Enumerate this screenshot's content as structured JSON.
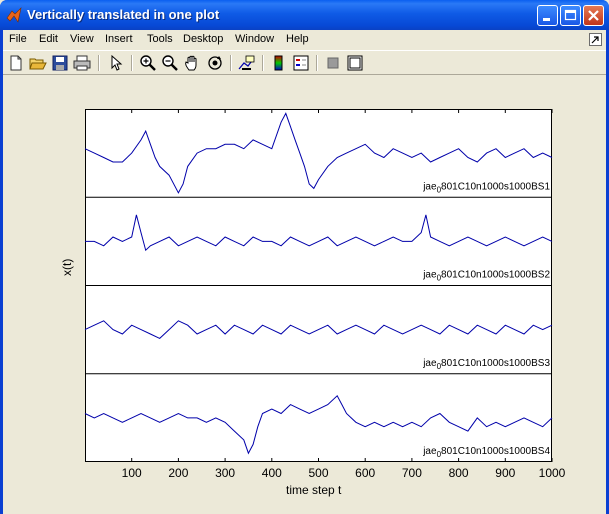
{
  "window": {
    "title": "Vertically translated in one plot"
  },
  "menu": {
    "items": [
      "File",
      "Edit",
      "View",
      "Insert",
      "Tools",
      "Desktop",
      "Window",
      "Help"
    ]
  },
  "toolbar": {
    "icons": [
      "new-figure-icon",
      "open-file-icon",
      "save-icon",
      "print-icon",
      "pointer-icon",
      "zoom-in-icon",
      "zoom-out-icon",
      "pan-icon",
      "rotate-3d-icon",
      "data-cursor-icon",
      "colorbar-icon",
      "legend-icon",
      "hide-plot-tools-icon",
      "show-plot-tools-icon"
    ]
  },
  "chart_data": {
    "type": "line",
    "xlabel": "time step t",
    "ylabel": "x(t)",
    "xlim": [
      0,
      1000
    ],
    "xticks": [
      100,
      200,
      300,
      400,
      500,
      600,
      700,
      800,
      900,
      1000
    ],
    "line_color": "#0000aa",
    "series": [
      {
        "name_prefix": "jae",
        "name_sub": "0",
        "name_suffix": "801C10n1000s1000BS1",
        "x": [
          0,
          20,
          40,
          60,
          80,
          100,
          120,
          130,
          140,
          150,
          160,
          180,
          200,
          210,
          220,
          240,
          260,
          280,
          300,
          320,
          340,
          360,
          380,
          400,
          420,
          430,
          440,
          450,
          460,
          470,
          480,
          490,
          500,
          520,
          540,
          560,
          580,
          600,
          620,
          640,
          660,
          680,
          700,
          720,
          740,
          760,
          780,
          800,
          820,
          840,
          860,
          880,
          900,
          920,
          940,
          960,
          980,
          1000
        ],
        "y": [
          0.1,
          0.0,
          -0.1,
          -0.2,
          -0.2,
          0.0,
          0.3,
          0.5,
          0.2,
          -0.1,
          -0.3,
          -0.5,
          -0.9,
          -0.7,
          -0.3,
          0.0,
          0.1,
          0.1,
          0.2,
          0.2,
          0.1,
          0.3,
          0.2,
          0.1,
          0.7,
          0.9,
          0.6,
          0.3,
          0.0,
          -0.3,
          -0.7,
          -0.8,
          -0.6,
          -0.3,
          -0.1,
          0.0,
          0.1,
          0.2,
          0.0,
          -0.1,
          0.1,
          0.0,
          -0.1,
          0.0,
          -0.2,
          -0.1,
          0.0,
          0.1,
          -0.1,
          -0.2,
          0.0,
          0.1,
          -0.1,
          0.0,
          0.1,
          -0.1,
          0.0,
          -0.1
        ]
      },
      {
        "name_prefix": "jae",
        "name_sub": "0",
        "name_suffix": "801C10n1000s1000BS2",
        "x": [
          0,
          20,
          40,
          60,
          80,
          100,
          110,
          120,
          130,
          140,
          160,
          180,
          200,
          220,
          240,
          260,
          280,
          300,
          320,
          340,
          360,
          380,
          400,
          420,
          440,
          460,
          480,
          500,
          520,
          540,
          560,
          580,
          600,
          620,
          640,
          660,
          680,
          700,
          720,
          730,
          740,
          760,
          780,
          800,
          820,
          840,
          860,
          880,
          900,
          920,
          940,
          960,
          980,
          1000
        ],
        "y": [
          0.0,
          0.0,
          -0.1,
          0.1,
          0.0,
          0.1,
          0.6,
          0.2,
          -0.2,
          -0.1,
          0.0,
          0.1,
          -0.1,
          0.0,
          0.1,
          0.0,
          -0.1,
          0.1,
          0.0,
          -0.1,
          0.1,
          0.0,
          0.0,
          -0.1,
          0.1,
          0.0,
          -0.1,
          0.0,
          0.1,
          -0.1,
          0.0,
          0.1,
          0.0,
          -0.1,
          0.0,
          0.1,
          0.0,
          0.0,
          0.2,
          0.6,
          0.1,
          0.0,
          -0.1,
          0.0,
          0.1,
          0.0,
          -0.1,
          0.0,
          0.1,
          0.0,
          -0.1,
          0.0,
          0.1,
          0.0
        ]
      },
      {
        "name_prefix": "jae",
        "name_sub": "0",
        "name_suffix": "801C10n1000s1000BS3",
        "x": [
          0,
          20,
          40,
          60,
          80,
          100,
          120,
          140,
          160,
          180,
          200,
          220,
          240,
          260,
          280,
          300,
          320,
          340,
          360,
          380,
          400,
          420,
          440,
          460,
          480,
          500,
          520,
          540,
          560,
          580,
          600,
          620,
          640,
          660,
          680,
          700,
          720,
          740,
          760,
          780,
          800,
          820,
          840,
          860,
          880,
          900,
          920,
          940,
          960,
          980,
          1000
        ],
        "y": [
          0.0,
          0.1,
          0.2,
          0.0,
          -0.1,
          0.1,
          0.0,
          -0.1,
          -0.2,
          0.0,
          0.2,
          0.1,
          -0.1,
          0.0,
          0.1,
          -0.1,
          0.1,
          0.0,
          -0.1,
          0.1,
          0.0,
          -0.1,
          0.1,
          0.0,
          -0.1,
          0.0,
          0.1,
          -0.1,
          0.0,
          0.1,
          0.0,
          -0.1,
          0.1,
          0.0,
          -0.1,
          0.0,
          0.1,
          0.0,
          -0.1,
          0.1,
          0.0,
          -0.1,
          0.1,
          0.0,
          -0.1,
          0.1,
          0.0,
          -0.1,
          0.1,
          0.0,
          0.1
        ]
      },
      {
        "name_prefix": "jae",
        "name_sub": "0",
        "name_suffix": "801C10n1000s1000BS4",
        "x": [
          0,
          20,
          40,
          60,
          80,
          100,
          120,
          140,
          160,
          180,
          200,
          220,
          240,
          260,
          280,
          300,
          320,
          340,
          350,
          360,
          370,
          380,
          400,
          420,
          440,
          460,
          480,
          500,
          520,
          540,
          550,
          560,
          580,
          600,
          620,
          640,
          660,
          680,
          700,
          720,
          740,
          760,
          780,
          800,
          820,
          840,
          860,
          880,
          900,
          920,
          940,
          960,
          980,
          1000
        ],
        "y": [
          0.1,
          0.0,
          0.1,
          0.0,
          -0.1,
          0.0,
          0.1,
          0.0,
          -0.1,
          0.0,
          0.1,
          0.0,
          0.0,
          -0.1,
          0.0,
          -0.1,
          -0.3,
          -0.5,
          -0.8,
          -0.6,
          -0.2,
          0.1,
          0.2,
          0.1,
          0.3,
          0.2,
          0.1,
          0.2,
          0.3,
          0.5,
          0.3,
          0.1,
          -0.1,
          -0.2,
          -0.1,
          -0.2,
          -0.1,
          -0.2,
          -0.1,
          -0.2,
          0.0,
          0.1,
          -0.1,
          -0.2,
          -0.3,
          0.0,
          -0.2,
          -0.1,
          -0.2,
          -0.1,
          0.0,
          -0.1,
          -0.2,
          0.0
        ]
      }
    ]
  }
}
